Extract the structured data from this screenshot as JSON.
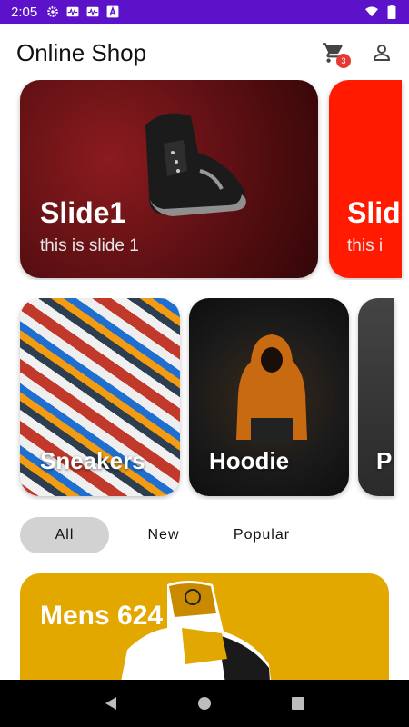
{
  "status_bar": {
    "time": "2:05"
  },
  "app_bar": {
    "title": "Online Shop",
    "cart_count": "3"
  },
  "slides": [
    {
      "title": "Slide1",
      "subtitle": "this is slide 1"
    },
    {
      "title": "Slide",
      "subtitle": "this i"
    }
  ],
  "categories": [
    {
      "label": "Sneakers"
    },
    {
      "label": "Hoodie"
    },
    {
      "label": "P"
    }
  ],
  "filters": {
    "items": [
      "All",
      "New",
      "Popular"
    ],
    "selected": "All"
  },
  "products": [
    {
      "name": "Mens 624"
    }
  ],
  "colors": {
    "status_bar": "#5b12c9",
    "slide2": "#ff1a00",
    "product_card": "#e2a800",
    "chip_active": "#d2d2d2",
    "badge": "#e53935"
  }
}
